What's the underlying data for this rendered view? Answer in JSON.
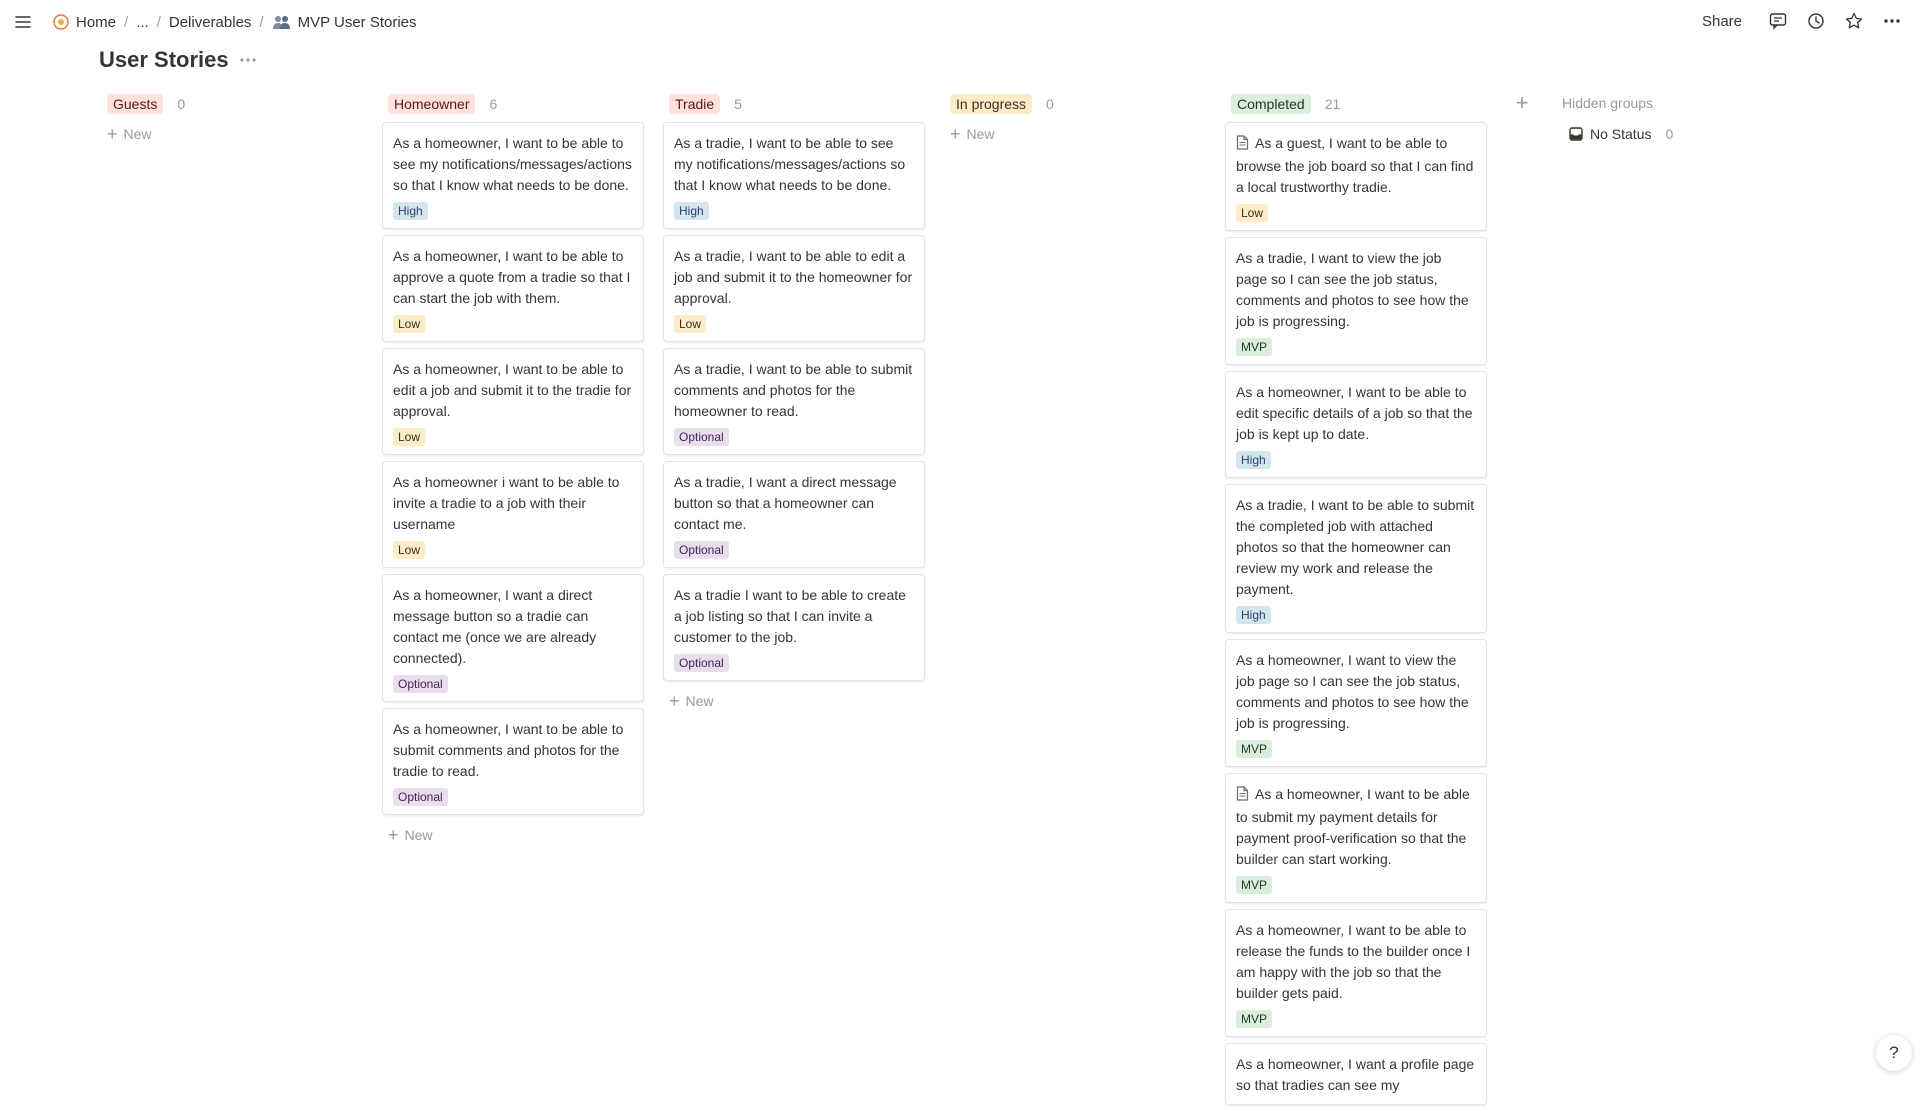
{
  "breadcrumb": {
    "items": [
      {
        "label": "Home",
        "icon": "home-icon"
      },
      {
        "label": "..."
      },
      {
        "label": "Deliverables"
      },
      {
        "label": "MVP User Stories",
        "icon": "people-icon"
      }
    ]
  },
  "topbar": {
    "share_label": "Share"
  },
  "page": {
    "title": "User Stories"
  },
  "tag_colors": {
    "High": {
      "bg": "#d3e5ef",
      "fg": "#28456c"
    },
    "Low": {
      "bg": "#fdecc8",
      "fg": "#402c1b"
    },
    "Optional": {
      "bg": "#e8deee",
      "fg": "#412454"
    },
    "MVP": {
      "bg": "#dbeddb",
      "fg": "#1c3829"
    }
  },
  "new_label": "New",
  "columns": [
    {
      "name": "Guests",
      "count": "0",
      "color_bg": "#ffe2dd",
      "color_fg": "#5d1715",
      "cards": [],
      "show_new": true
    },
    {
      "name": "Homeowner",
      "count": "6",
      "color_bg": "#ffe2dd",
      "color_fg": "#5d1715",
      "show_new": true,
      "cards": [
        {
          "text": "As a homeowner, I want to be able to see my notifications/messages/actions so that I know what needs to be done.",
          "tag": "High"
        },
        {
          "text": "As a homeowner, I want to be able to approve a quote from a tradie so that I can start the job with them.",
          "tag": "Low"
        },
        {
          "text": "As a homeowner, I want to be able to edit a job and submit it to the tradie for approval.",
          "tag": "Low"
        },
        {
          "text": "As a homeowner i want to be able to invite a tradie to a job with their username",
          "tag": "Low"
        },
        {
          "text": "As a homeowner, I want a direct message button so a tradie can contact me (once we are already connected).",
          "tag": "Optional"
        },
        {
          "text": "As a homeowner, I want to be able to submit comments and photos for the tradie to read.",
          "tag": "Optional"
        }
      ]
    },
    {
      "name": "Tradie",
      "count": "5",
      "color_bg": "#ffe2dd",
      "color_fg": "#5d1715",
      "show_new": true,
      "cards": [
        {
          "text": "As a tradie, I want to be able to see my notifications/messages/actions so that I know what needs to be done.",
          "tag": "High"
        },
        {
          "text": "As a tradie, I want to be able to edit a job and submit it to the homeowner for approval.",
          "tag": "Low"
        },
        {
          "text": "As a tradie, I want to be able to submit comments and photos for the homeowner to read.",
          "tag": "Optional"
        },
        {
          "text": "As a tradie, I want a direct message button so that a homeowner can contact me.",
          "tag": "Optional"
        },
        {
          "text": "As a tradie I want to be able to create a job listing so that I can invite a customer to the job.",
          "tag": "Optional"
        }
      ]
    },
    {
      "name": "In progress",
      "count": "0",
      "color_bg": "#fdecc8",
      "color_fg": "#402c1b",
      "cards": [],
      "show_new": true
    },
    {
      "name": "Completed",
      "count": "21",
      "color_bg": "#dbeddb",
      "color_fg": "#1c3829",
      "show_new": false,
      "cards": [
        {
          "text": "As a guest, I want to be able to browse the job board so that I can find a local trustworthy tradie.",
          "tag": "Low",
          "doc_icon": true
        },
        {
          "text": "As a tradie, I want to view the job page so I can see the job status, comments and photos to see how the job is progressing.",
          "tag": "MVP"
        },
        {
          "text": "As a homeowner, I want to be able to edit specific details of a job so that the job is kept up to date.",
          "tag": "High"
        },
        {
          "text": "As a tradie, I want to be able to submit the completed job with attached photos so that the homeowner can review my work and release the payment.",
          "tag": "High"
        },
        {
          "text": "As a homeowner, I want to view the job page so I can see the job status, comments and photos to see how the job is progressing.",
          "tag": "MVP"
        },
        {
          "text": "As a homeowner, I want to be able to submit my payment details for payment proof-verification so that the builder can start working.",
          "tag": "MVP",
          "doc_icon": true
        },
        {
          "text": "As a homeowner, I want to be able to release the funds to the builder once I am happy with the job so that the builder gets paid.",
          "tag": "MVP"
        },
        {
          "text": "As a homeowner, I want a profile page so that tradies can see my",
          "tag": ""
        }
      ]
    }
  ],
  "hidden_groups": {
    "label": "Hidden groups",
    "items": [
      {
        "label": "No Status",
        "count": "0"
      }
    ]
  },
  "help_label": "?"
}
